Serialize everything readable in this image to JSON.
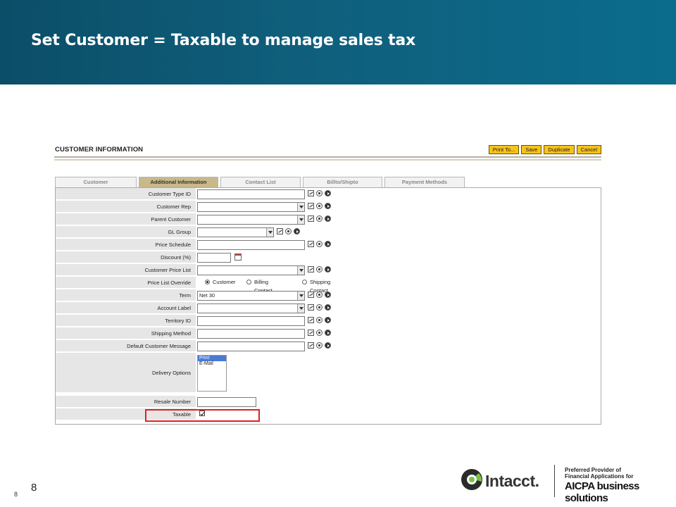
{
  "slide": {
    "title": "Set Customer = Taxable to manage sales tax",
    "page_small": "8",
    "page_big": "8"
  },
  "screen": {
    "section_title": "CUSTOMER INFORMATION",
    "buttons": [
      "Print To...",
      "Save",
      "Duplicate",
      "Cancel"
    ],
    "tabs": [
      "Customer",
      "Additional Information",
      "Contact List",
      "Billto/Shipto",
      "Payment Methods"
    ],
    "active_tab": "Additional Information",
    "fields": {
      "customer_type_id": {
        "label": "Customer Type ID",
        "value": ""
      },
      "customer_rep": {
        "label": "Customer Rep",
        "value": ""
      },
      "parent_customer": {
        "label": "Parent Customer",
        "value": ""
      },
      "gl_group": {
        "label": "GL Group",
        "value": ""
      },
      "price_schedule": {
        "label": "Price Schedule",
        "value": ""
      },
      "discount": {
        "label": "Discount (%)",
        "value": ""
      },
      "customer_price_list": {
        "label": "Customer Price List",
        "value": ""
      },
      "price_list_override": {
        "label": "Price List Override",
        "options": [
          "Customer",
          "Billing Contact",
          "Shipping Contact"
        ],
        "selected": "Customer"
      },
      "term": {
        "label": "Term",
        "value": "Net 30"
      },
      "account_label": {
        "label": "Account Label",
        "value": ""
      },
      "territory_id": {
        "label": "Territory ID",
        "value": ""
      },
      "shipping_method": {
        "label": "Shipping Method",
        "value": ""
      },
      "default_customer_message": {
        "label": "Default Customer Message",
        "value": ""
      },
      "delivery_options": {
        "label": "Delivery Options",
        "options": [
          "Print",
          "E-Mail"
        ],
        "selected": "Print"
      },
      "resale_number": {
        "label": "Resale Number",
        "value": ""
      },
      "taxable": {
        "label": "Taxable",
        "checked": true
      }
    },
    "highlight_color": "#e02020"
  },
  "footer": {
    "brand": "Intacct.",
    "provider_line1": "Preferred Provider of",
    "provider_line2": "Financial Applications for",
    "provider_brand": "AICPA business solutions"
  },
  "colors": {
    "banner": "#0f5f7c",
    "button": "#f7c21a",
    "active_tab": "#c9b98a"
  }
}
